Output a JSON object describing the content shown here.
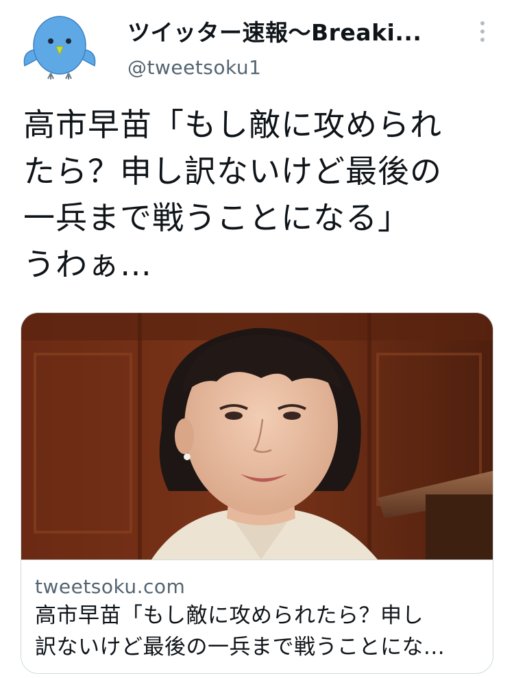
{
  "tweet": {
    "avatar_icon": "blue-bird-avatar-icon",
    "display_name": "ツイッター速報〜Breaki...",
    "handle": "@tweetsoku1",
    "more_icon": "vertical-dots-icon",
    "text_lines": [
      "高市早苗「もし敵に攻められ",
      "たら？申し訳ないけど最後の",
      "一兵まで戦うことになる」",
      "うわぁ…"
    ]
  },
  "card": {
    "image": "portrait-photo",
    "domain": "tweetsoku.com",
    "title_lines": [
      "高市早苗「もし敵に攻められたら？申し",
      "訳ないけど最後の一兵まで戦うことにな..."
    ]
  },
  "colors": {
    "text": "#0f1419",
    "secondary": "#536471",
    "border": "#cfd9de",
    "avatar_blue": "#5fa8e6",
    "beak": "#c8e234"
  }
}
